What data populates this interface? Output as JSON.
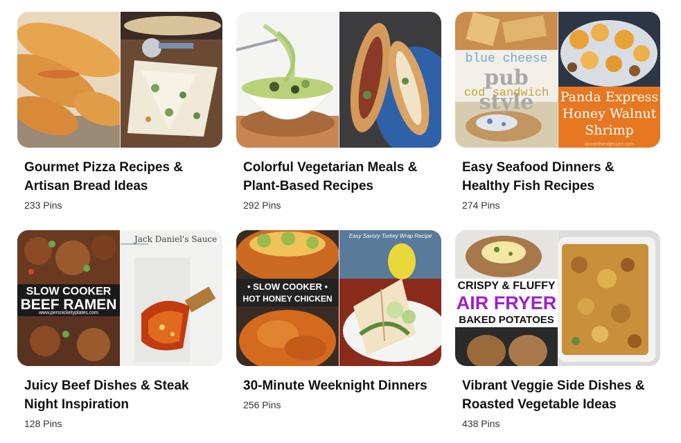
{
  "boards": [
    {
      "title": "Gourmet Pizza Recipes & Artisan Bread Ideas",
      "pins": "233 Pins",
      "left_image": "calzone-bread-photo",
      "right_image": "white-pizza-slices-photo"
    },
    {
      "title": "Colorful Vegetarian Meals & Plant-Based Recipes",
      "pins": "292 Pins",
      "left_image": "zucchini-noodles-bowl-photo",
      "right_image": "stuffed-hoagie-photo"
    },
    {
      "title": "Easy Seafood Dinners & Healthy Fish Recipes",
      "pins": "274 Pins",
      "left_image": "cod-sandwich-photo",
      "left_overlay": [
        "blue cheese",
        "pub style",
        "cod sandwich"
      ],
      "right_image": "honey-walnut-shrimp-photo",
      "right_overlay": [
        "Panda Express",
        "Honey Walnut",
        "Shrimp"
      ],
      "right_overlay_bg": "#e87722",
      "right_watermark": "dinnerthendessert.com"
    },
    {
      "title": "Juicy Beef Dishes & Steak Night Inspiration",
      "pins": "128 Pins",
      "left_image": "beef-ramen-photo",
      "left_overlay": [
        "SLOW COOKER",
        "BEEF RAMEN"
      ],
      "left_watermark": "www.persnicketyplates.com",
      "right_image": "basting-brush-sauce-photo",
      "right_overlay": [
        "Jack Daniel's Sauce"
      ]
    },
    {
      "title": "30-Minute Weeknight Dinners",
      "pins": "256 Pins",
      "left_image": "hot-honey-chicken-photo",
      "left_overlay": [
        "• SLOW COOKER •",
        "HOT HONEY CHICKEN"
      ],
      "right_image": "turkey-wrap-photo",
      "right_overlay": [
        "Easy Savory Turkey Wrap Recipe"
      ]
    },
    {
      "title": "Vibrant Veggie Side Dishes & Roasted Vegetable Ideas",
      "pins": "438 Pins",
      "left_image": "air-fryer-potatoes-photo",
      "left_overlay": [
        "CRISPY & FLUFFY",
        "AIR FRYER",
        "BAKED POTATOES"
      ],
      "left_overlay_accent": "#a020c8",
      "right_image": "green-bean-casserole-photo"
    }
  ]
}
